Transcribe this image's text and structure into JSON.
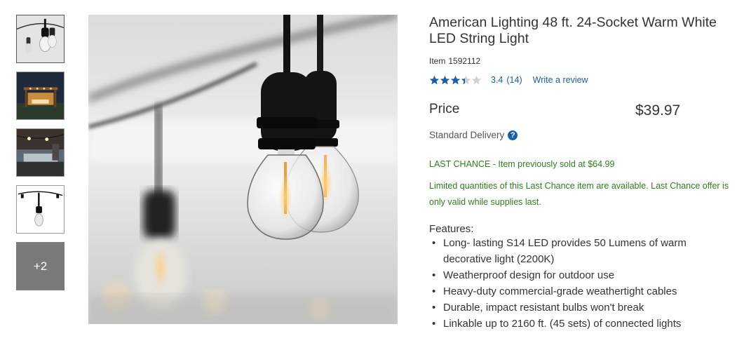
{
  "product": {
    "title": "American Lighting 48 ft. 24-Socket Warm White LED String Light",
    "item_label": "Item",
    "item_number": "1592112",
    "rating": "3.4",
    "review_count": "(14)",
    "rating_value": 3.4,
    "rating_max": 5,
    "write_review": "Write a review",
    "price_label": "Price",
    "price": "$39.97",
    "delivery": "Standard Delivery",
    "help_icon": "?",
    "last_chance": "LAST CHANCE - Item previously sold at $64.99",
    "limited_notice": "Limited quantities of this Last Chance item are available. Last Chance offer is only valid while supplies last.",
    "features_title": "Features:",
    "features": [
      "Long- lasting S14 LED provides 50 Lumens of warm decorative light (2200K)",
      "Weatherproof design for outdoor use",
      "Heavy-duty commercial-grade weathertight cables",
      "Durable, impact resistant bulbs won't break",
      "Linkable up to 2160 ft. (45 sets) of connected lights"
    ]
  },
  "gallery": {
    "more_label": "+2"
  },
  "colors": {
    "link": "#1b5fa4",
    "star": "#1b5fa4",
    "last_chance": "#2f7d1c"
  }
}
